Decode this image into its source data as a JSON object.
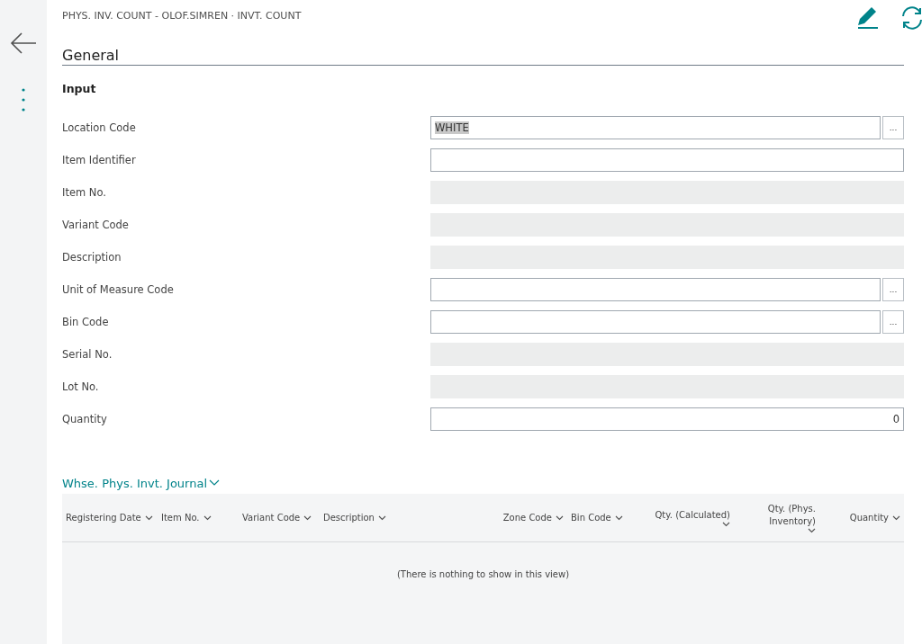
{
  "breadcrumb": "PHYS. INV. COUNT - OLOF.SIMREN · INVT. COUNT",
  "section_title": "General",
  "group_title": "Input",
  "fields": [
    {
      "label": "Location Code",
      "kind": "lookup",
      "value": "WHITE",
      "value_selected": true
    },
    {
      "label": "Item Identifier",
      "kind": "text"
    },
    {
      "label": "Item No.",
      "kind": "readonly"
    },
    {
      "label": "Variant Code",
      "kind": "readonly"
    },
    {
      "label": "Description",
      "kind": "readonly"
    },
    {
      "label": "Unit of Measure Code",
      "kind": "lookup"
    },
    {
      "label": "Bin Code",
      "kind": "lookup"
    },
    {
      "label": "Serial No.",
      "kind": "readonly"
    },
    {
      "label": "Lot No.",
      "kind": "readonly"
    },
    {
      "label": "Quantity",
      "kind": "number",
      "value": "0"
    }
  ],
  "lookup_button": "...",
  "journal": {
    "title": "Whse. Phys. Invt. Journal",
    "columns": [
      {
        "label": "Registering Date",
        "kind": "text"
      },
      {
        "label": "Item No.",
        "kind": "text"
      },
      {
        "label": "Variant Code",
        "kind": "text"
      },
      {
        "label": "Description",
        "kind": "text"
      },
      {
        "label": "Zone Code",
        "kind": "number"
      },
      {
        "label": "Bin Code",
        "kind": "text"
      },
      {
        "label": "Qty. (Calculated)",
        "kind": "number"
      },
      {
        "label": "Qty. (Phys. Inventory)",
        "kind": "number"
      },
      {
        "label": "Quantity",
        "kind": "number"
      }
    ],
    "empty_message": "(There is nothing to show in this view)"
  }
}
